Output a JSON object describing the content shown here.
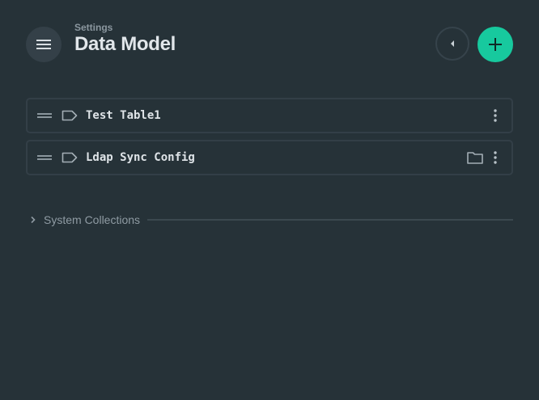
{
  "header": {
    "breadcrumb": "Settings",
    "title": "Data Model",
    "menu_icon": "hamburger-icon",
    "back_icon": "caret-left-icon",
    "add_icon": "plus-icon"
  },
  "collections": [
    {
      "label": "Test Table1",
      "icon": "tag-icon",
      "has_folder": false
    },
    {
      "label": "Ldap Sync Config",
      "icon": "tag-icon",
      "has_folder": true
    }
  ],
  "system": {
    "label": "System Collections",
    "expanded": false
  },
  "colors": {
    "background": "#263238",
    "accent": "#17c99e",
    "border": "#333f47",
    "muted_text": "#8f9ba3"
  }
}
